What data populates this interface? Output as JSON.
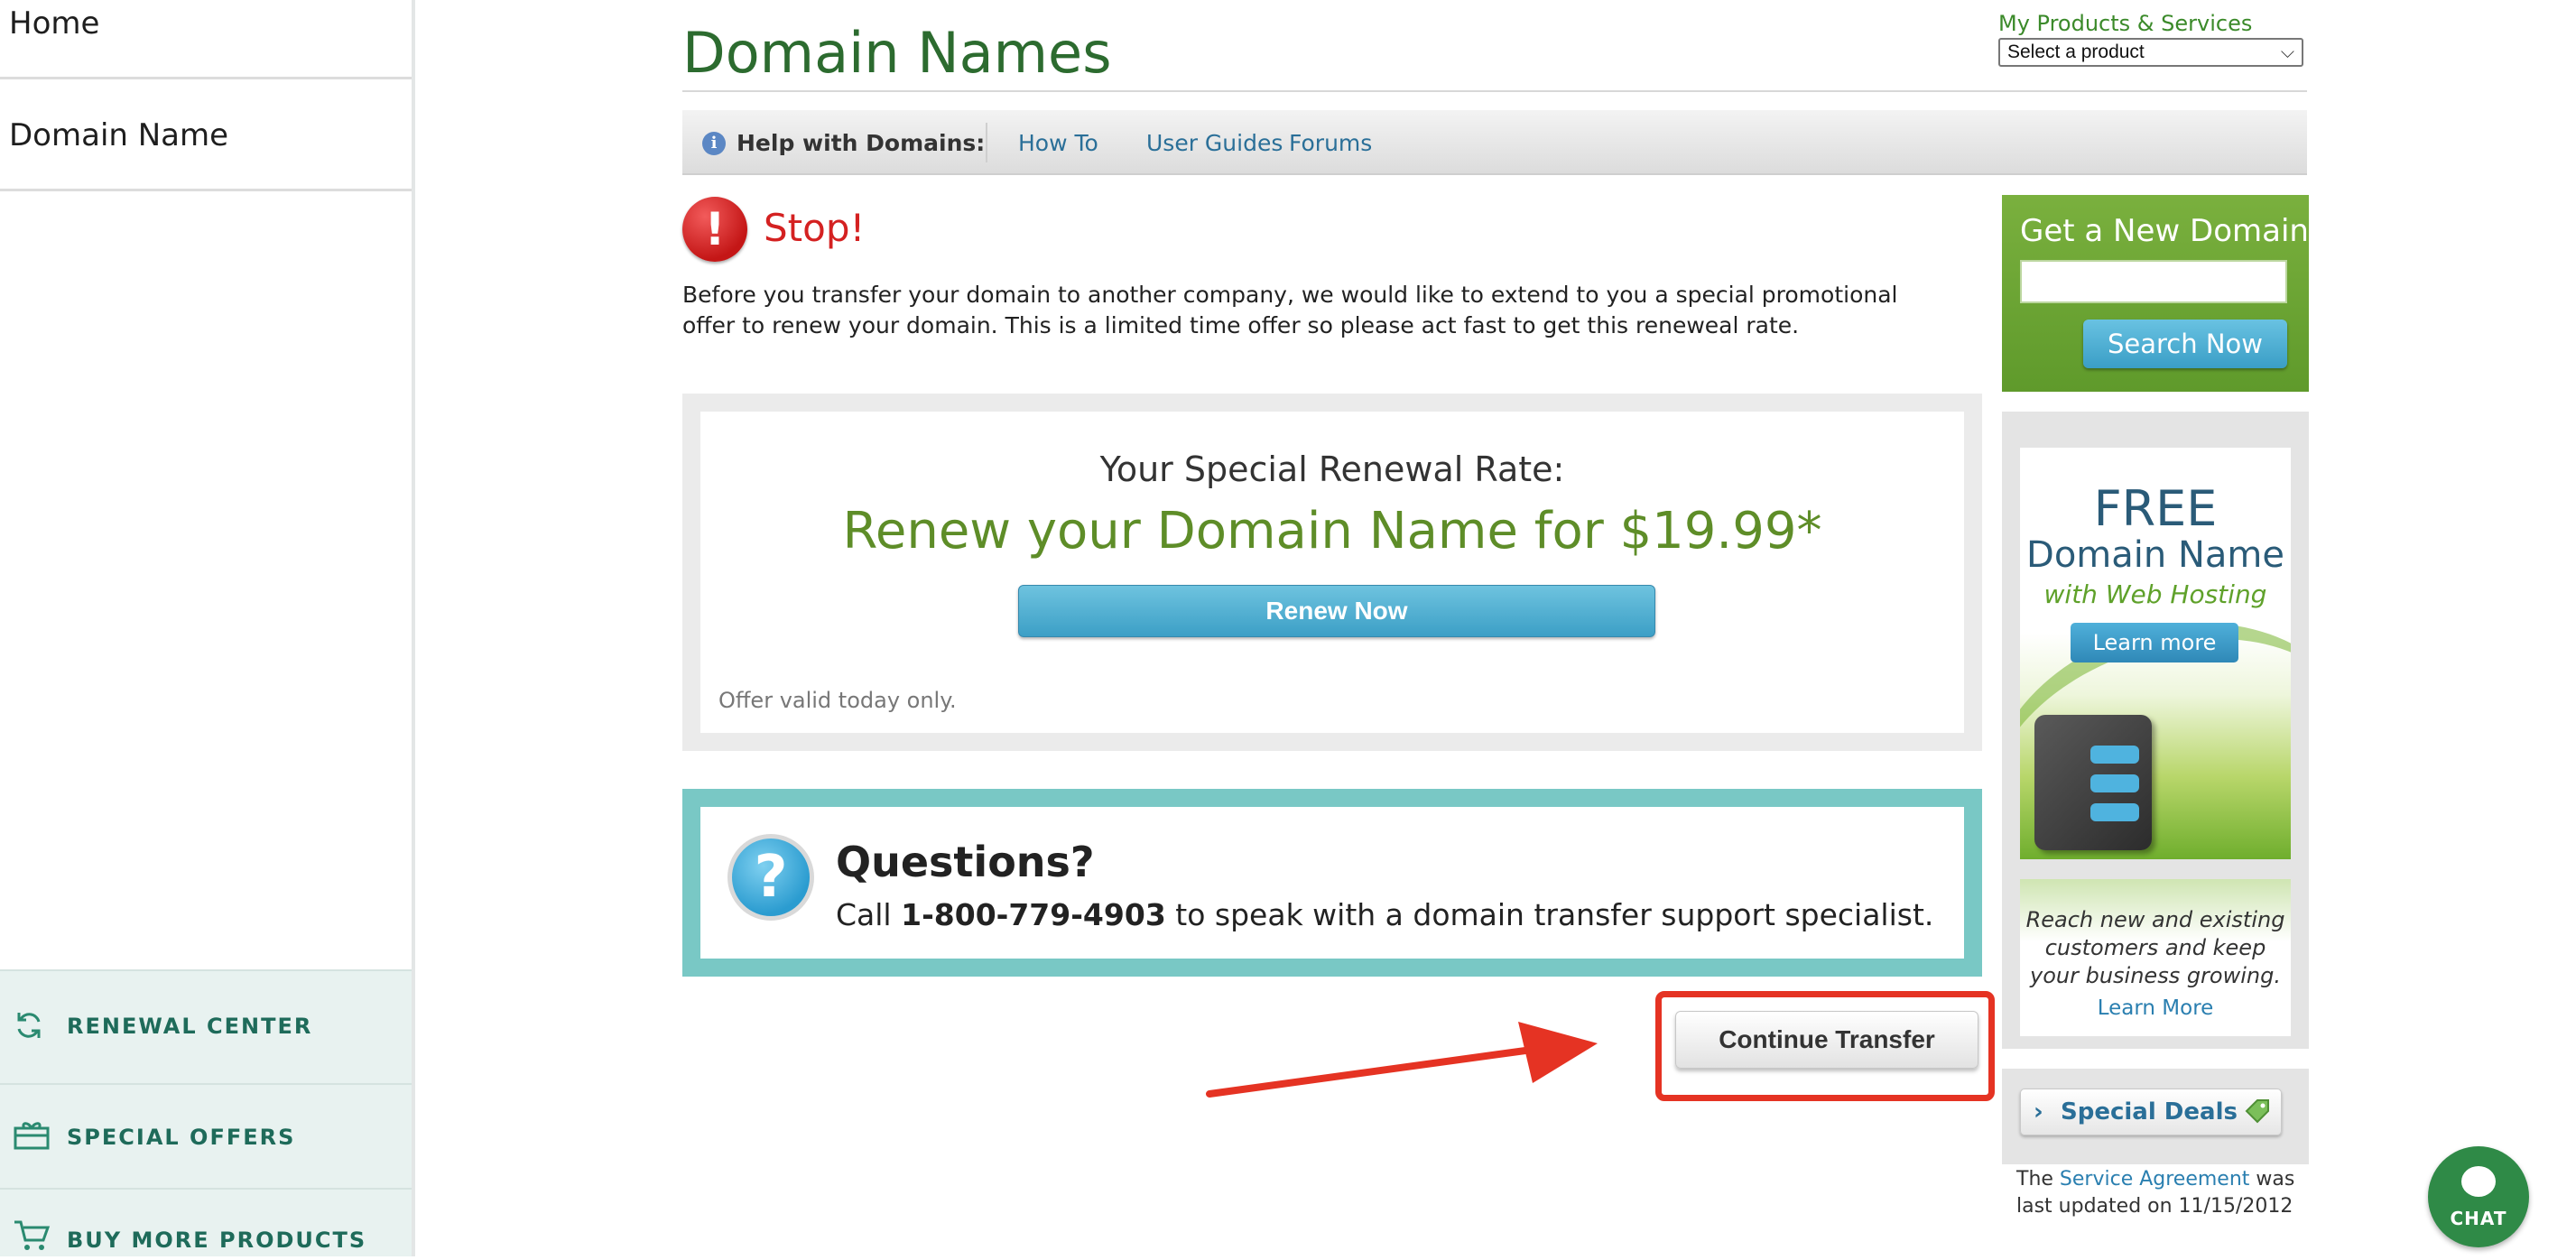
{
  "sidebar": {
    "home": "Home",
    "domain_name": "Domain Name",
    "bottom": [
      {
        "label": "RENEWAL CENTER",
        "icon": "renew-icon"
      },
      {
        "label": "SPECIAL OFFERS",
        "icon": "gift-icon"
      },
      {
        "label": "BUY MORE PRODUCTS",
        "icon": "cart-icon"
      }
    ]
  },
  "header": {
    "title": "Domain Names",
    "my_products_label": "My Products & Services",
    "product_select_value": "Select a product"
  },
  "help_bar": {
    "title": "Help with Domains:",
    "links": [
      "How To",
      "User Guides",
      "Forums"
    ]
  },
  "stop": {
    "heading": "Stop!",
    "message": "Before you transfer your domain to another company, we would like to extend to you a special promotional offer to renew your domain. This is a limited time offer so please act fast to get this reneweal rate."
  },
  "offer": {
    "heading": "Your Special Renewal Rate:",
    "headline": "Renew your Domain Name for $19.99*",
    "renew_button": "Renew Now",
    "validity": "Offer valid today only."
  },
  "questions": {
    "title": "Questions?",
    "prefix": "Call",
    "phone": "1-800-779-4903",
    "suffix": "to speak with a domain transfer support specialist."
  },
  "continue_button": "Continue Transfer",
  "new_domain": {
    "title": "Get a New Domain",
    "search_button": "Search Now",
    "input_value": ""
  },
  "ads": {
    "hosting": {
      "free": "FREE",
      "domain": "Domain Name",
      "with_hosting": "with Web Hosting",
      "learn": "Learn more"
    },
    "grow": {
      "text": "Reach new and existing customers and keep your business growing.",
      "learn": "Learn More"
    }
  },
  "special_deals": "Special Deals",
  "service_note": {
    "prefix": "The",
    "link": "Service Agreement",
    "suffix": "was last updated on 11/15/2012"
  },
  "chat": "CHAT",
  "colors": {
    "title_green": "#2c6b2f",
    "stop_red": "#d42121",
    "offer_green": "#5e8d28",
    "teal_border": "#79c8c5",
    "annotation_red": "#e53323"
  }
}
